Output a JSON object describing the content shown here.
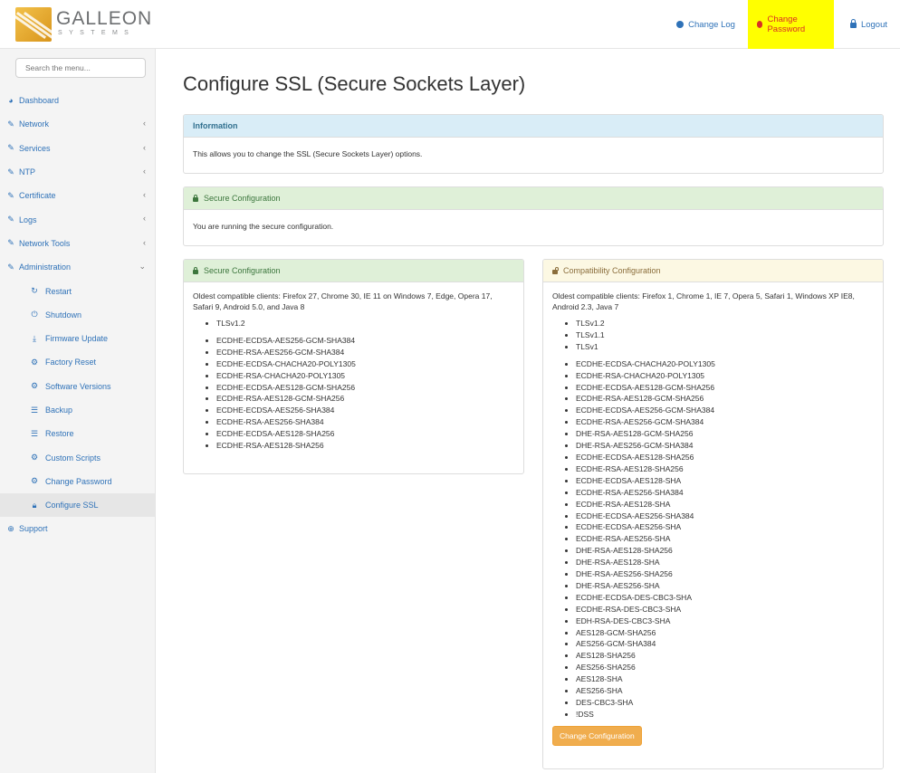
{
  "header": {
    "logo_text": "GALLEON",
    "logo_sub": "SYSTEMS",
    "nav": {
      "changelog": "Change Log",
      "change_password": "Change Password",
      "logout": "Logout"
    }
  },
  "sidebar": {
    "search_placeholder": "Search the menu...",
    "items": [
      {
        "label": "Dashboard",
        "icon": "dashboard-icon"
      },
      {
        "label": "Network",
        "icon": "wrench-icon"
      },
      {
        "label": "Services",
        "icon": "wrench-icon"
      },
      {
        "label": "NTP",
        "icon": "wrench-icon"
      },
      {
        "label": "Certificate",
        "icon": "wrench-icon"
      },
      {
        "label": "Logs",
        "icon": "wrench-icon"
      },
      {
        "label": "Network Tools",
        "icon": "wrench-icon"
      },
      {
        "label": "Administration",
        "icon": "wrench-icon"
      }
    ],
    "sub_items": [
      {
        "label": "Restart",
        "icon": "restart-icon"
      },
      {
        "label": "Shutdown",
        "icon": "power-icon"
      },
      {
        "label": "Firmware Update",
        "icon": "download-icon"
      },
      {
        "label": "Factory Reset",
        "icon": "gear-icon"
      },
      {
        "label": "Software Versions",
        "icon": "gear-icon"
      },
      {
        "label": "Backup",
        "icon": "database-icon"
      },
      {
        "label": "Restore",
        "icon": "database-icon"
      },
      {
        "label": "Custom Scripts",
        "icon": "gear-icon"
      },
      {
        "label": "Change Password",
        "icon": "gear-icon"
      },
      {
        "label": "Configure SSL",
        "icon": "lock-icon"
      }
    ],
    "support": {
      "label": "Support",
      "icon": "support-icon"
    }
  },
  "main": {
    "title": "Configure SSL (Secure Sockets Layer)",
    "info": {
      "heading": "Information",
      "text": "This allows you to change the SSL (Secure Sockets Layer) options."
    },
    "status": {
      "heading": "Secure Configuration",
      "text": "You are running the secure configuration."
    },
    "secure": {
      "heading": "Secure Configuration",
      "clients": "Oldest compatible clients: Firefox 27, Chrome 30, IE 11 on Windows 7, Edge, Opera 17, Safari 9, Android 5.0, and Java 8",
      "protocols": [
        "TLSv1.2"
      ],
      "ciphers": [
        "ECDHE-ECDSA-AES256-GCM-SHA384",
        "ECDHE-RSA-AES256-GCM-SHA384",
        "ECDHE-ECDSA-CHACHA20-POLY1305",
        "ECDHE-RSA-CHACHA20-POLY1305",
        "ECDHE-ECDSA-AES128-GCM-SHA256",
        "ECDHE-RSA-AES128-GCM-SHA256",
        "ECDHE-ECDSA-AES256-SHA384",
        "ECDHE-RSA-AES256-SHA384",
        "ECDHE-ECDSA-AES128-SHA256",
        "ECDHE-RSA-AES128-SHA256"
      ]
    },
    "compat": {
      "heading": "Compatibility Configuration",
      "clients": "Oldest compatible clients: Firefox 1, Chrome 1, IE 7, Opera 5, Safari 1, Windows XP IE8, Android 2.3, Java 7",
      "protocols": [
        "TLSv1.2",
        "TLSv1.1",
        "TLSv1"
      ],
      "ciphers": [
        "ECDHE-ECDSA-CHACHA20-POLY1305",
        "ECDHE-RSA-CHACHA20-POLY1305",
        "ECDHE-ECDSA-AES128-GCM-SHA256",
        "ECDHE-RSA-AES128-GCM-SHA256",
        "ECDHE-ECDSA-AES256-GCM-SHA384",
        "ECDHE-RSA-AES256-GCM-SHA384",
        "DHE-RSA-AES128-GCM-SHA256",
        "DHE-RSA-AES256-GCM-SHA384",
        "ECDHE-ECDSA-AES128-SHA256",
        "ECDHE-RSA-AES128-SHA256",
        "ECDHE-ECDSA-AES128-SHA",
        "ECDHE-RSA-AES256-SHA384",
        "ECDHE-RSA-AES128-SHA",
        "ECDHE-ECDSA-AES256-SHA384",
        "ECDHE-ECDSA-AES256-SHA",
        "ECDHE-RSA-AES256-SHA",
        "DHE-RSA-AES128-SHA256",
        "DHE-RSA-AES128-SHA",
        "DHE-RSA-AES256-SHA256",
        "DHE-RSA-AES256-SHA",
        "ECDHE-ECDSA-DES-CBC3-SHA",
        "ECDHE-RSA-DES-CBC3-SHA",
        "EDH-RSA-DES-CBC3-SHA",
        "AES128-GCM-SHA256",
        "AES256-GCM-SHA384",
        "AES128-SHA256",
        "AES256-SHA256",
        "AES128-SHA",
        "AES256-SHA",
        "DES-CBC3-SHA",
        "!DSS"
      ],
      "button": "Change Configuration"
    }
  },
  "colors": {
    "link": "#2f72b8",
    "highlight": "#ffff00",
    "danger": "#d93025",
    "warning_button": "#f0ad4e"
  }
}
